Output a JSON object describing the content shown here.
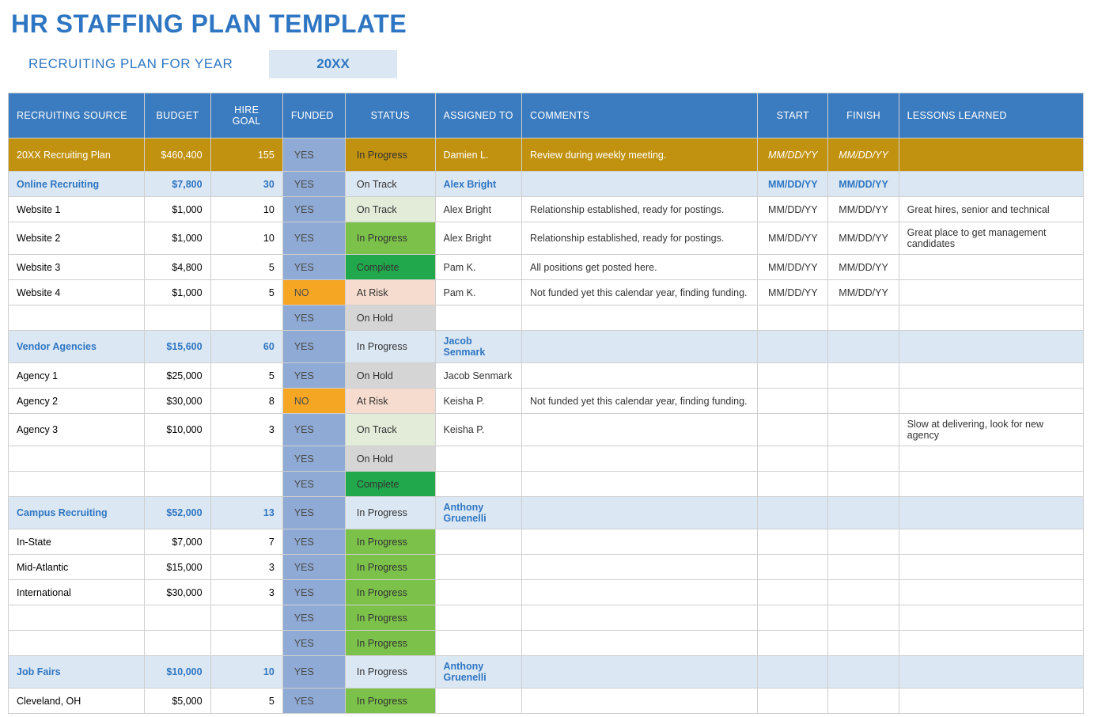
{
  "title": "HR STAFFING PLAN TEMPLATE",
  "subhead": {
    "label": "RECRUITING PLAN FOR YEAR",
    "year": "20XX"
  },
  "columns": {
    "source": "RECRUITING SOURCE",
    "budget": "BUDGET",
    "hire": "HIRE GOAL",
    "funded": "FUNDED",
    "status": "STATUS",
    "assigned": "ASSIGNED TO",
    "comments": "COMMENTS",
    "start": "START",
    "finish": "FINISH",
    "lessons": "LESSONS LEARNED"
  },
  "status_labels": {
    "inprogress": "In Progress",
    "ontrack": "On Track",
    "complete": "Complete",
    "atrisk": "At Risk",
    "onhold": "On Hold"
  },
  "funded_labels": {
    "yes": "YES",
    "no": "NO"
  },
  "rows": [
    {
      "type": "total",
      "source": "20XX Recruiting Plan",
      "budget": "$460,400",
      "hire": "155",
      "funded": "yes",
      "status": "inprogress",
      "assigned": "Damien L.",
      "comments": "Review during weekly meeting.",
      "start": "MM/DD/YY",
      "finish": "MM/DD/YY",
      "lessons": ""
    },
    {
      "type": "section",
      "source": "Online Recruiting",
      "budget": "$7,800",
      "hire": "30",
      "funded": "yes",
      "status": "ontrack",
      "assigned": "Alex Bright",
      "comments": "",
      "start": "MM/DD/YY",
      "finish": "MM/DD/YY",
      "lessons": ""
    },
    {
      "type": "item",
      "source": "Website 1",
      "budget": "$1,000",
      "hire": "10",
      "funded": "yes",
      "status": "ontrack",
      "assigned": "Alex Bright",
      "comments": "Relationship established, ready for postings.",
      "start": "MM/DD/YY",
      "finish": "MM/DD/YY",
      "lessons": "Great hires, senior and technical"
    },
    {
      "type": "item",
      "source": "Website 2",
      "budget": "$1,000",
      "hire": "10",
      "funded": "yes",
      "status": "inprogress",
      "assigned": "Alex Bright",
      "comments": "Relationship established, ready for postings.",
      "start": "MM/DD/YY",
      "finish": "MM/DD/YY",
      "lessons": "Great place to get management candidates"
    },
    {
      "type": "item",
      "source": "Website 3",
      "budget": "$4,800",
      "hire": "5",
      "funded": "yes",
      "status": "complete",
      "assigned": "Pam K.",
      "comments": "All positions get posted here.",
      "start": "MM/DD/YY",
      "finish": "MM/DD/YY",
      "lessons": ""
    },
    {
      "type": "item",
      "source": "Website 4",
      "budget": "$1,000",
      "hire": "5",
      "funded": "no",
      "status": "atrisk",
      "assigned": "Pam K.",
      "comments": "Not funded yet this calendar year, finding funding.",
      "start": "MM/DD/YY",
      "finish": "MM/DD/YY",
      "lessons": ""
    },
    {
      "type": "item",
      "source": "",
      "budget": "",
      "hire": "",
      "funded": "yes",
      "status": "onhold",
      "assigned": "",
      "comments": "",
      "start": "",
      "finish": "",
      "lessons": ""
    },
    {
      "type": "section",
      "source": "Vendor Agencies",
      "budget": "$15,600",
      "hire": "60",
      "funded": "yes",
      "status": "inprogress",
      "assigned": "Jacob Senmark",
      "comments": "",
      "start": "",
      "finish": "",
      "lessons": ""
    },
    {
      "type": "item",
      "source": "Agency 1",
      "budget": "$25,000",
      "hire": "5",
      "funded": "yes",
      "status": "onhold",
      "assigned": "Jacob Senmark",
      "comments": "",
      "start": "",
      "finish": "",
      "lessons": ""
    },
    {
      "type": "item",
      "source": "Agency 2",
      "budget": "$30,000",
      "hire": "8",
      "funded": "no",
      "status": "atrisk",
      "assigned": "Keisha P.",
      "comments": "Not funded yet this calendar year, finding funding.",
      "start": "",
      "finish": "",
      "lessons": ""
    },
    {
      "type": "item",
      "source": "Agency 3",
      "budget": "$10,000",
      "hire": "3",
      "funded": "yes",
      "status": "ontrack",
      "assigned": "Keisha P.",
      "comments": "",
      "start": "",
      "finish": "",
      "lessons": "Slow at delivering, look for new agency"
    },
    {
      "type": "item",
      "source": "",
      "budget": "",
      "hire": "",
      "funded": "yes",
      "status": "onhold",
      "assigned": "",
      "comments": "",
      "start": "",
      "finish": "",
      "lessons": ""
    },
    {
      "type": "item",
      "source": "",
      "budget": "",
      "hire": "",
      "funded": "yes",
      "status": "complete",
      "assigned": "",
      "comments": "",
      "start": "",
      "finish": "",
      "lessons": ""
    },
    {
      "type": "section",
      "source": "Campus Recruiting",
      "budget": "$52,000",
      "hire": "13",
      "funded": "yes",
      "status": "inprogress",
      "assigned": "Anthony Gruenelli",
      "comments": "",
      "start": "",
      "finish": "",
      "lessons": ""
    },
    {
      "type": "item",
      "source": "In-State",
      "budget": "$7,000",
      "hire": "7",
      "funded": "yes",
      "status": "inprogress",
      "assigned": "",
      "comments": "",
      "start": "",
      "finish": "",
      "lessons": ""
    },
    {
      "type": "item",
      "source": "Mid-Atlantic",
      "budget": "$15,000",
      "hire": "3",
      "funded": "yes",
      "status": "inprogress",
      "assigned": "",
      "comments": "",
      "start": "",
      "finish": "",
      "lessons": ""
    },
    {
      "type": "item",
      "source": "International",
      "budget": "$30,000",
      "hire": "3",
      "funded": "yes",
      "status": "inprogress",
      "assigned": "",
      "comments": "",
      "start": "",
      "finish": "",
      "lessons": ""
    },
    {
      "type": "item",
      "source": "",
      "budget": "",
      "hire": "",
      "funded": "yes",
      "status": "inprogress",
      "assigned": "",
      "comments": "",
      "start": "",
      "finish": "",
      "lessons": ""
    },
    {
      "type": "item",
      "source": "",
      "budget": "",
      "hire": "",
      "funded": "yes",
      "status": "inprogress",
      "assigned": "",
      "comments": "",
      "start": "",
      "finish": "",
      "lessons": ""
    },
    {
      "type": "section",
      "source": "Job Fairs",
      "budget": "$10,000",
      "hire": "10",
      "funded": "yes",
      "status": "inprogress",
      "assigned": "Anthony Gruenelli",
      "comments": "",
      "start": "",
      "finish": "",
      "lessons": ""
    },
    {
      "type": "item",
      "source": "Cleveland, OH",
      "budget": "$5,000",
      "hire": "5",
      "funded": "yes",
      "status": "inprogress",
      "assigned": "",
      "comments": "",
      "start": "",
      "finish": "",
      "lessons": ""
    }
  ]
}
